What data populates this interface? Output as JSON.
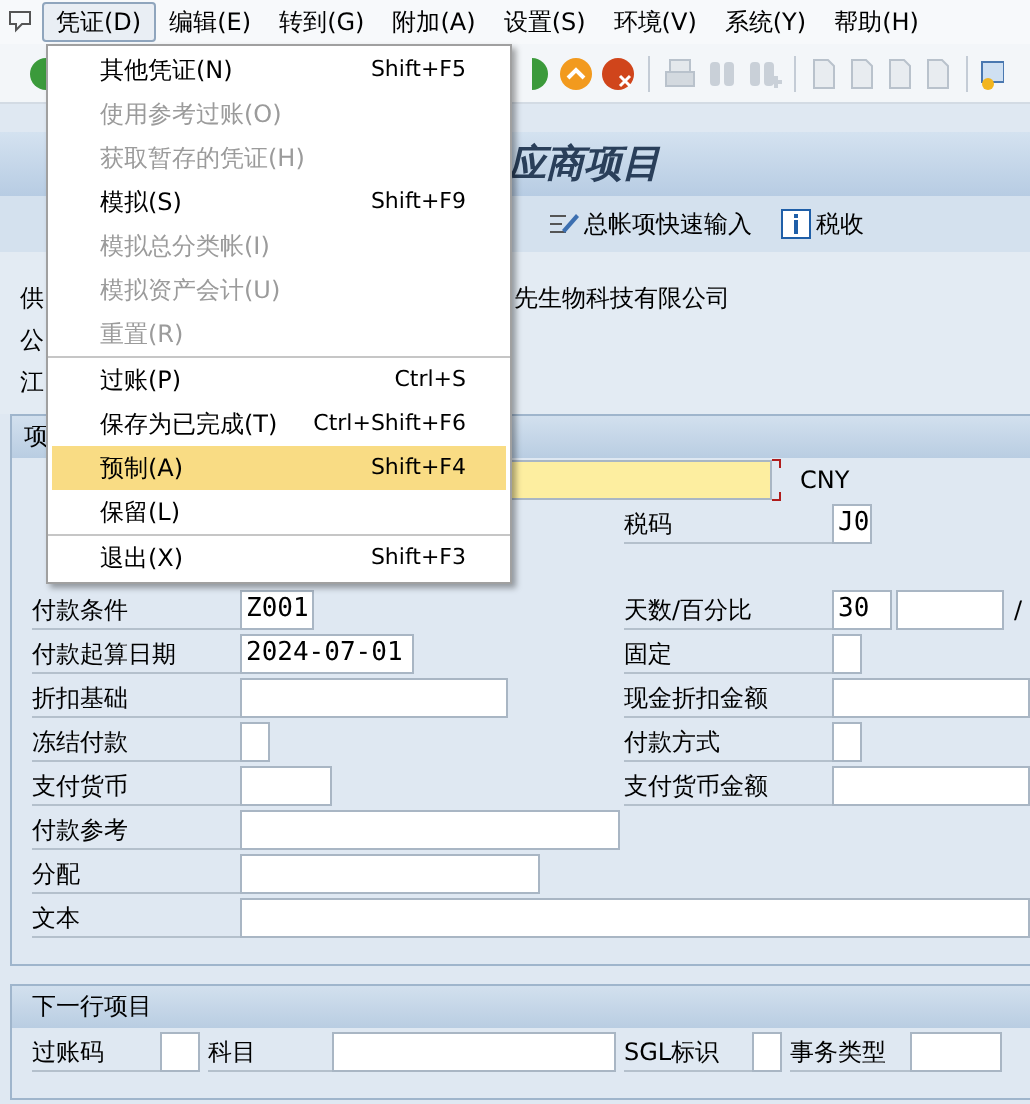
{
  "menubar": [
    {
      "label": "凭证(D)",
      "selected": true
    },
    {
      "label": "编辑(E)",
      "selected": false
    },
    {
      "label": "转到(G)",
      "selected": false
    },
    {
      "label": "附加(A)",
      "selected": false
    },
    {
      "label": "设置(S)",
      "selected": false
    },
    {
      "label": "环境(V)",
      "selected": false
    },
    {
      "label": "系统(Y)",
      "selected": false
    },
    {
      "label": "帮助(H)",
      "selected": false
    }
  ],
  "menu": {
    "groups": [
      [
        {
          "label": "其他凭证(N)",
          "shortcut": "Shift+F5",
          "disabled": false,
          "selected": false
        },
        {
          "label": "使用参考过账(O)",
          "disabled": true,
          "selected": false
        },
        {
          "label": "获取暂存的凭证(H)",
          "disabled": true,
          "selected": false
        },
        {
          "label": "模拟(S)",
          "shortcut": "Shift+F9",
          "disabled": false,
          "selected": false
        },
        {
          "label": "模拟总分类帐(I)",
          "disabled": true,
          "selected": false
        },
        {
          "label": "模拟资产会计(U)",
          "disabled": true,
          "selected": false
        },
        {
          "label": "重置(R)",
          "disabled": true,
          "selected": false
        }
      ],
      [
        {
          "label": "过账(P)",
          "shortcut": "Ctrl+S",
          "disabled": false,
          "selected": false
        },
        {
          "label": "保存为已完成(T)",
          "shortcut": "Ctrl+Shift+F6",
          "disabled": false,
          "selected": false
        },
        {
          "label": "预制(A)",
          "shortcut": "Shift+F4",
          "disabled": false,
          "selected": true
        },
        {
          "label": "保留(L)",
          "disabled": false,
          "selected": false
        }
      ],
      [
        {
          "label": "退出(X)",
          "shortcut": "Shift+F3",
          "disabled": false,
          "selected": false
        }
      ]
    ]
  },
  "title": "应商项目",
  "app_toolbar": [
    {
      "label": "总帐项快速输入",
      "kind": "edit"
    },
    {
      "label": "税收",
      "kind": "info"
    }
  ],
  "header": {
    "rows": [
      {
        "label": "供",
        "value": "先生物科技有限公司"
      },
      {
        "label": "公"
      },
      {
        "label": "江"
      }
    ]
  },
  "item_panel": {
    "tab": "项",
    "amount": {
      "required": true,
      "currency": "CNY"
    },
    "tax": {
      "label": "税码",
      "value": "J0"
    },
    "left": [
      {
        "label": "付款条件",
        "value": "Z001",
        "kind": "code"
      },
      {
        "label": "付款起算日期",
        "value": "2024-07-01",
        "kind": "date"
      },
      {
        "label": "折扣基础",
        "kind": "medium"
      },
      {
        "label": "冻结付款",
        "kind": "flag"
      },
      {
        "label": "支付货币",
        "kind": "short"
      },
      {
        "label": "付款参考",
        "kind": "long"
      },
      {
        "label": "分配",
        "kind": "wide"
      },
      {
        "label": "文本",
        "kind": "full"
      }
    ],
    "right": [
      {
        "label": "天数/百分比",
        "value": "30",
        "kind": "days",
        "suffix": "/"
      },
      {
        "label": "固定",
        "kind": "flag"
      },
      {
        "label": "现金折扣金额",
        "kind": "full"
      },
      {
        "label": "付款方式",
        "kind": "flag"
      },
      {
        "label": "支付货币金额",
        "kind": "full"
      }
    ]
  },
  "next_item": {
    "title": "下一行项目",
    "fields": [
      {
        "label": "过账码",
        "kind": "flag2"
      },
      {
        "label": "科目",
        "kind": "account"
      },
      {
        "label": "SGL标识",
        "kind": "flag"
      },
      {
        "label": "事务类型",
        "kind": "short"
      }
    ]
  }
}
